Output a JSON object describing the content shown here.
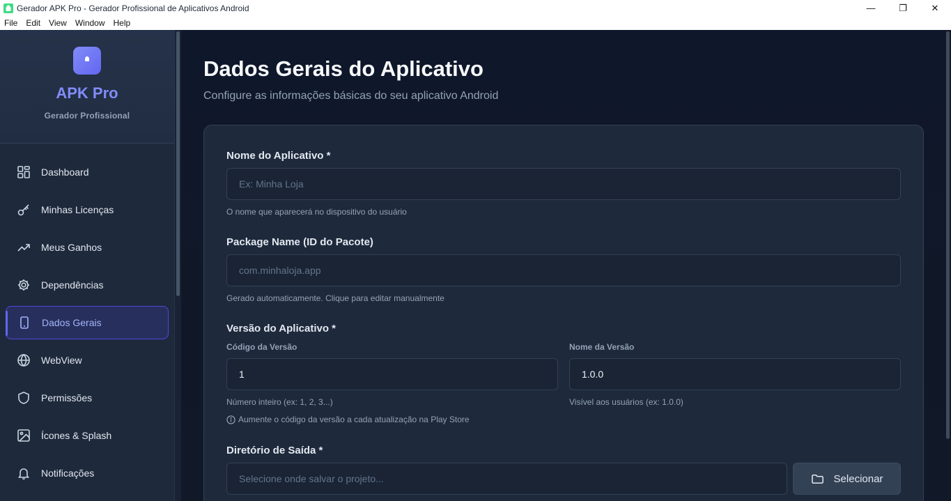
{
  "window": {
    "title": "Gerador APK Pro - Gerador Profissional de Aplicativos Android",
    "minimize": "—",
    "maximize": "❐",
    "close": "✕"
  },
  "menu": [
    "File",
    "Edit",
    "View",
    "Window",
    "Help"
  ],
  "brand": {
    "title": "APK Pro",
    "subtitle": "Gerador Profissional"
  },
  "sidebar": {
    "items": [
      {
        "label": "Dashboard",
        "icon": "grid-icon"
      },
      {
        "label": "Minhas Licenças",
        "icon": "key-icon"
      },
      {
        "label": "Meus Ganhos",
        "icon": "trending-up-icon"
      },
      {
        "label": "Dependências",
        "icon": "gear-icon"
      },
      {
        "label": "Dados Gerais",
        "icon": "smartphone-icon",
        "active": true
      },
      {
        "label": "WebView",
        "icon": "globe-icon"
      },
      {
        "label": "Permissões",
        "icon": "shield-icon"
      },
      {
        "label": "Ícones & Splash",
        "icon": "image-icon"
      },
      {
        "label": "Notificações",
        "icon": "bell-icon"
      }
    ]
  },
  "page": {
    "title": "Dados Gerais do Aplicativo",
    "subtitle": "Configure as informações básicas do seu aplicativo Android"
  },
  "form": {
    "app_name": {
      "label": "Nome do Aplicativo *",
      "placeholder": "Ex: Minha Loja",
      "value": "",
      "hint": "O nome que aparecerá no dispositivo do usuário"
    },
    "package_name": {
      "label": "Package Name (ID do Pacote)",
      "placeholder": "com.minhaloja.app",
      "value": "",
      "hint": "Gerado automaticamente. Clique para editar manualmente"
    },
    "version": {
      "label": "Versão do Aplicativo *",
      "code_label": "Código da Versão",
      "code_value": "1",
      "code_hint": "Número inteiro (ex: 1, 2, 3...)",
      "name_label": "Nome da Versão",
      "name_value": "1.0.0",
      "name_hint": "Visível aos usuários (ex: 1.0.0)",
      "info": "Aumente o código da versão a cada atualização na Play Store"
    },
    "output_dir": {
      "label": "Diretório de Saída *",
      "placeholder": "Selecione onde salvar o projeto...",
      "value": "",
      "button": "Selecionar"
    }
  },
  "colors": {
    "accent": "#6366f1",
    "background": "#111827",
    "sidebar": "#1e293b",
    "card": "#1e293b"
  }
}
